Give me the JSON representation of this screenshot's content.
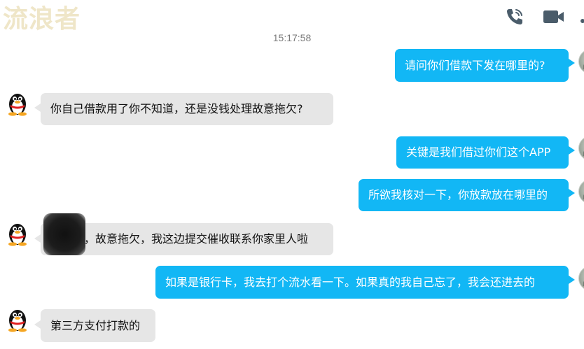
{
  "header": {
    "watermark": "流浪者",
    "icons": [
      "phone-call-icon",
      "video-camera-icon",
      "more-icon"
    ]
  },
  "chat": {
    "timestamp": "15:17:58",
    "messages": [
      {
        "side": "out",
        "text": "请问你们借款下发在哪里的?"
      },
      {
        "side": "in",
        "text": "你自己借款用了你不知道，还是没钱处理故意拖欠?"
      },
      {
        "side": "out",
        "text": "关键是我们借过你们这个APP"
      },
      {
        "side": "out",
        "text": "所欲我核对一下，你放款放在哪里的"
      },
      {
        "side": "in",
        "text": "侯女士，故意拖欠，我这边提交催收联系你家里人啦"
      },
      {
        "side": "out",
        "text": "如果是银行卡，我去打个流水看一下。如果真的我自己忘了，我会还进去的"
      },
      {
        "side": "in",
        "text": "第三方支付打款的"
      }
    ]
  },
  "colors": {
    "outgoing_bubble": "#12b7f5",
    "incoming_bubble": "#e6e6e6",
    "watermark": "#efe6c8",
    "icon": "#4a5c6a"
  }
}
